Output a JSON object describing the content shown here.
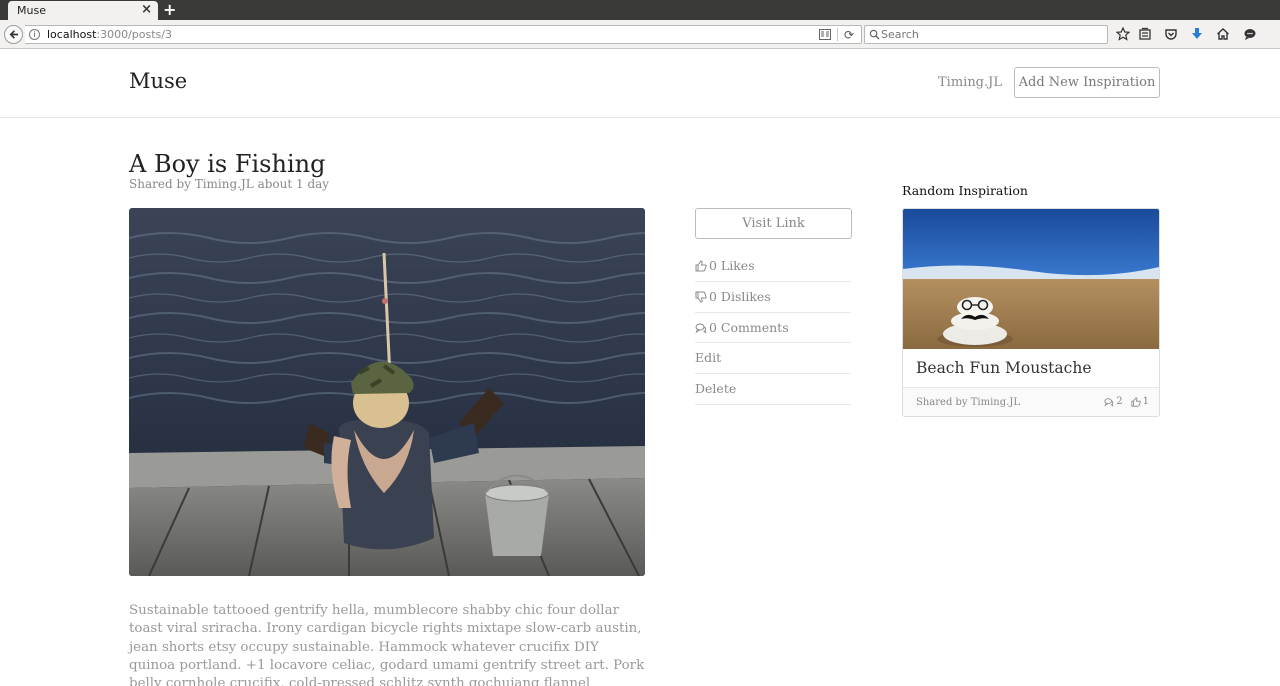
{
  "browser": {
    "tab_title": "Muse",
    "tab_close": "×",
    "new_tab": "+",
    "url_host": "localhost",
    "url_path": ":3000/posts/3",
    "search_placeholder": "Search",
    "icons": [
      "back-icon",
      "info-icon",
      "reader-view-icon",
      "reload-icon",
      "search-icon",
      "bookmark-star-icon",
      "library-icon",
      "pocket-icon",
      "download-icon",
      "home-icon",
      "chat-icon"
    ]
  },
  "header": {
    "brand": "Muse",
    "user": "Timing.JL",
    "add_button": "Add New Inspiration"
  },
  "post": {
    "title": "A Boy is Fishing",
    "meta": "Shared by Timing.JL about 1 day",
    "body": "Sustainable tattooed gentrify hella, mumblecore shabby chic four dollar toast viral sriracha. Irony cardigan bicycle rights mixtape slow-carb austin, jean shorts etsy occupy sustainable. Hammock whatever crucifix DIY quinoa portland. +1 locavore celiac, godard umami gentrify street art. Pork belly cornhole crucifix, cold-pressed schlitz synth gochujang flannel skateboard man"
  },
  "actions": {
    "visit_link": "Visit Link",
    "likes": "0 Likes",
    "dislikes": "0 Dislikes",
    "comments": "0 Comments",
    "edit": "Edit",
    "delete": "Delete"
  },
  "sidebar": {
    "heading": "Random Inspiration",
    "card": {
      "title": "Beach Fun Moustache",
      "shared": "Shared by Timing.JL",
      "comments": "2",
      "likes": "1"
    }
  },
  "colors": {
    "download_accent": "#2a7fd4",
    "muted_text": "#888888"
  }
}
